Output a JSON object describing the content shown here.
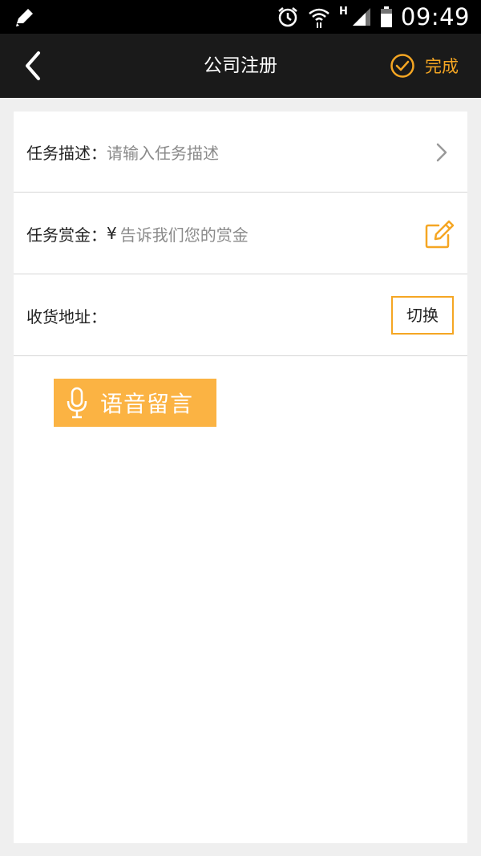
{
  "status_bar": {
    "time": "09:49",
    "network_type": "H",
    "icons": [
      "edit-notify-icon",
      "alarm-icon",
      "wifi-icon",
      "signal-icon",
      "battery-icon"
    ]
  },
  "header": {
    "title": "公司注册",
    "done_label": "完成",
    "accent_color": "#f5a623"
  },
  "form": {
    "task_description": {
      "label": "任务描述：",
      "placeholder": "请输入任务描述"
    },
    "task_reward": {
      "label": "任务赏金：",
      "currency": "¥",
      "placeholder": "告诉我们您的赏金"
    },
    "shipping_address": {
      "label": "收货地址：",
      "switch_label": "切换"
    }
  },
  "voice_message": {
    "label": "语音留言",
    "color": "#fbb343"
  }
}
